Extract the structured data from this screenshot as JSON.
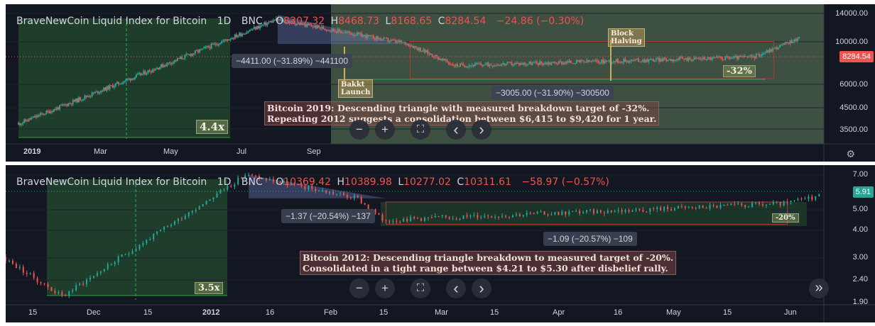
{
  "chart_data": [
    {
      "type": "candlestick",
      "title": "BraveNewCoin Liquid Index for Bitcoin",
      "interval": "1D",
      "exchange": "BNC",
      "ohlc_header": {
        "O": "8307.32",
        "H": "8468.73",
        "L": "8168.65",
        "C": "8284.54",
        "change": "−24.86 (−0.30%)"
      },
      "y_axis": {
        "ticks": [
          "14000.00",
          "10000.00",
          "6000.00",
          "4500.00",
          "3500.00"
        ],
        "current": "8284.54",
        "scale": "log"
      },
      "x_axis": {
        "ticks": [
          "2019",
          "Mar",
          "May",
          "Jul",
          "Sep"
        ]
      },
      "measures": [
        "−4411.00 (−31.89%) −441100",
        "−3005.00 (−31.90%) −300500"
      ],
      "rally_multiple": "4.4x",
      "target_label": "-32%",
      "events": [
        "Bakkt\nLaunch",
        "Block\nHalving"
      ],
      "annotation": [
        "Bitcoin 2019: Descending triangle with measured breakdown target of -32%.",
        "Repeating 2012 suggests a consolidation between $6,415 to $9,420 for 1 year."
      ],
      "series_segments": [
        {
          "from": "2019-01-01",
          "to": "2019-06-26",
          "start": 3700,
          "end": 13000
        },
        {
          "from": "2019-06-26",
          "to": "2019-09-24",
          "start": 13000,
          "end": 9700
        },
        {
          "from": "2019-09-24",
          "to": "2019-10-25",
          "start": 9700,
          "end": 7500
        },
        {
          "from": "2019-10-25",
          "to": "2020-05-15",
          "start": 7500,
          "end": 8300
        },
        {
          "from": "2020-05-15",
          "to": "2020-06-15",
          "start": 8300,
          "end": 10400
        }
      ]
    },
    {
      "type": "candlestick",
      "title": "BraveNewCoin Liquid Index for Bitcoin",
      "interval": "1D",
      "exchange": "BNC",
      "ohlc_header": {
        "O": "10369.42",
        "H": "10389.98",
        "L": "10277.02",
        "C": "10311.61",
        "change": "−58.97 (−0.57%)"
      },
      "y_axis": {
        "ticks": [
          "7.00",
          "5.00",
          "4.00",
          "3.00",
          "2.40",
          "1.90"
        ],
        "current": "5.91",
        "scale": "log"
      },
      "x_axis": {
        "ticks": [
          "15",
          "Dec",
          "15",
          "2012",
          "16",
          "Feb",
          "15",
          "Mar",
          "15",
          "Apr",
          "16",
          "May",
          "15",
          "Jun"
        ]
      },
      "measures": [
        "−1.37 (−20.54%) −137",
        "−1.09 (−20.57%) −109"
      ],
      "rally_multiple": "3.5x",
      "target_label": "-20%",
      "annotation": [
        "Bitcoin 2012: Descending triangle breakdown to measured target of -20%.",
        "Consolidated in a tight range between $4.21 to $5.30 after disbelief rally."
      ],
      "series_segments": [
        {
          "from": "2011-11-01",
          "to": "2011-11-18",
          "start": 3.0,
          "end": 2.0
        },
        {
          "from": "2011-11-18",
          "to": "2012-01-09",
          "start": 2.0,
          "end": 7.0
        },
        {
          "from": "2012-01-09",
          "to": "2012-02-10",
          "start": 7.0,
          "end": 5.5
        },
        {
          "from": "2012-02-10",
          "to": "2012-02-17",
          "start": 5.5,
          "end": 4.4
        },
        {
          "from": "2012-02-17",
          "to": "2012-06-10",
          "start": 4.4,
          "end": 5.2
        },
        {
          "from": "2012-06-10",
          "to": "2012-06-25",
          "start": 5.2,
          "end": 5.9
        }
      ]
    }
  ],
  "controls": {
    "zoom_out": "−",
    "zoom_in": "+",
    "fullscreen": "⛶",
    "prev": "‹",
    "next": "›",
    "scroll_end": "»",
    "settings": "⚙"
  },
  "colors": {
    "bg": "#131722",
    "up": "#26a69a",
    "down": "#ef5350",
    "axis_text": "#d1d4dc"
  }
}
